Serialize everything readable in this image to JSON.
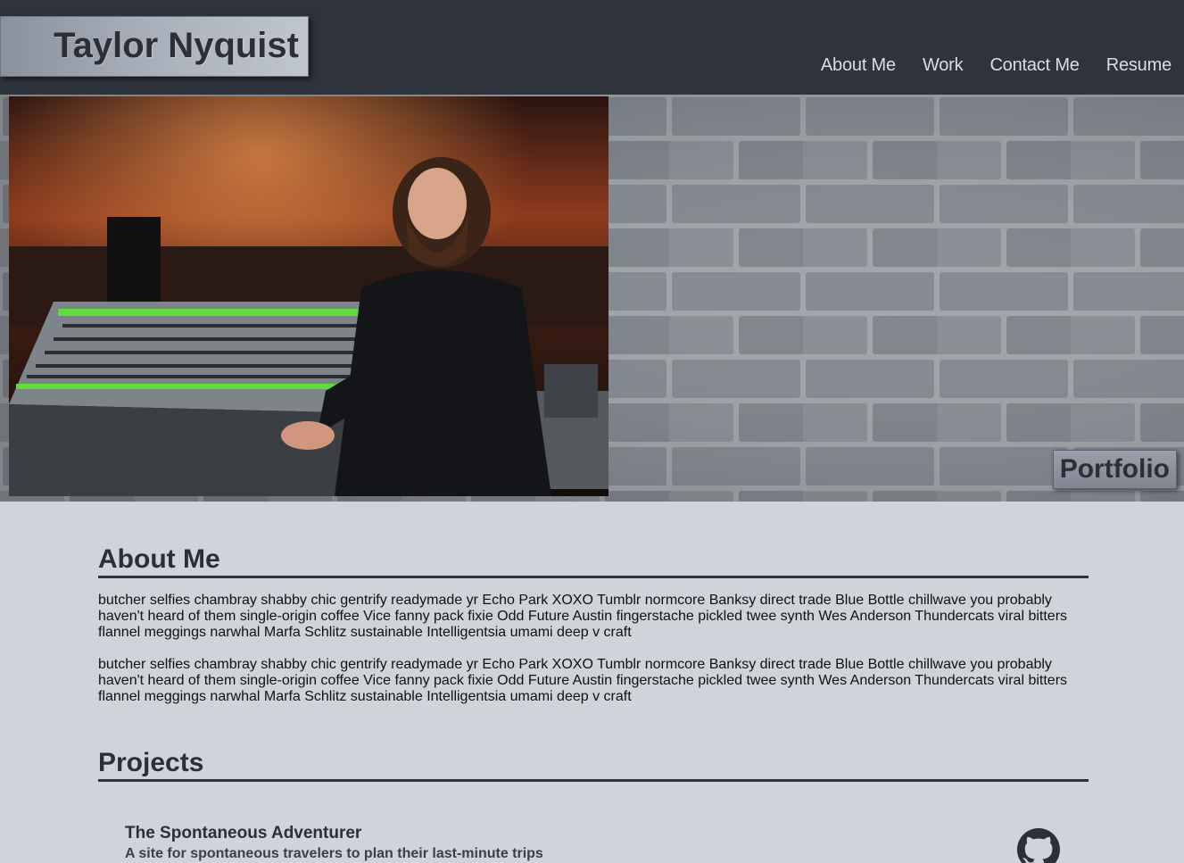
{
  "header": {
    "brand": "Taylor Nyquist",
    "nav": [
      "About Me",
      "Work",
      "Contact Me",
      "Resume"
    ]
  },
  "hero": {
    "photo_alt": "Taylor standing at a mixing console",
    "badge": "Portfolio"
  },
  "about": {
    "title": "About Me",
    "paragraphs": [
      "butcher selfies chambray shabby chic gentrify readymade yr Echo Park XOXO Tumblr normcore Banksy direct trade Blue Bottle chillwave you probably haven't heard of them single-origin coffee Vice fanny pack fixie Odd Future Austin fingerstache pickled twee synth Wes Anderson Thundercats viral bitters flannel meggings narwhal Marfa Schlitz sustainable Intelligentsia umami deep v craft",
      "butcher selfies chambray shabby chic gentrify readymade yr Echo Park XOXO Tumblr normcore Banksy direct trade Blue Bottle chillwave you probably haven't heard of them single-origin coffee Vice fanny pack fixie Odd Future Austin fingerstache pickled twee synth Wes Anderson Thundercats viral bitters flannel meggings narwhal Marfa Schlitz sustainable Intelligentsia umami deep v craft"
    ]
  },
  "projects": {
    "title": "Projects",
    "items": [
      {
        "title": "The Spontaneous Adventurer",
        "description": "A site for spontaneous travelers to plan their last-minute trips",
        "icon": "github-icon"
      }
    ]
  },
  "colors": {
    "header_bg": "#2f333c",
    "page_bg": "#cfd3da",
    "nav_text": "#d9dde4",
    "heading": "#2b2f37"
  }
}
